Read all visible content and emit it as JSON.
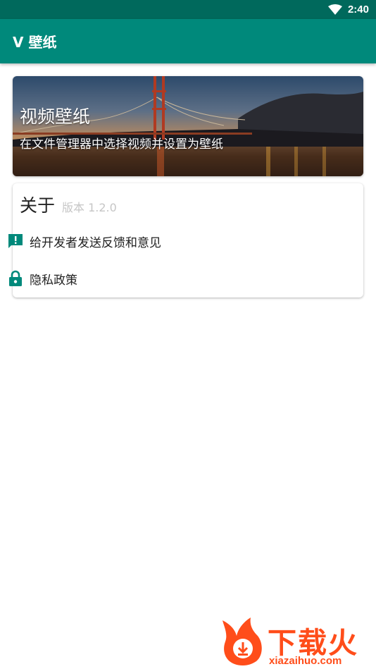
{
  "status_bar": {
    "time": "2:40"
  },
  "app_bar": {
    "title": "V 壁纸"
  },
  "banner": {
    "title": "视频壁纸",
    "subtitle": "在文件管理器中选择视频并设置为壁纸"
  },
  "about": {
    "label": "关于",
    "version": "版本 1.2.0",
    "items": [
      {
        "label": "给开发者发送反馈和意见",
        "icon": "feedback-icon"
      },
      {
        "label": "隐私政策",
        "icon": "lock-icon"
      }
    ]
  },
  "watermark": {
    "brand": "下载火",
    "domain": "xiazaihuo.com"
  },
  "colors": {
    "status_bar": "#00695c",
    "primary": "#00897b",
    "accent_icon": "#00897b",
    "watermark": "#ff4d1a"
  }
}
